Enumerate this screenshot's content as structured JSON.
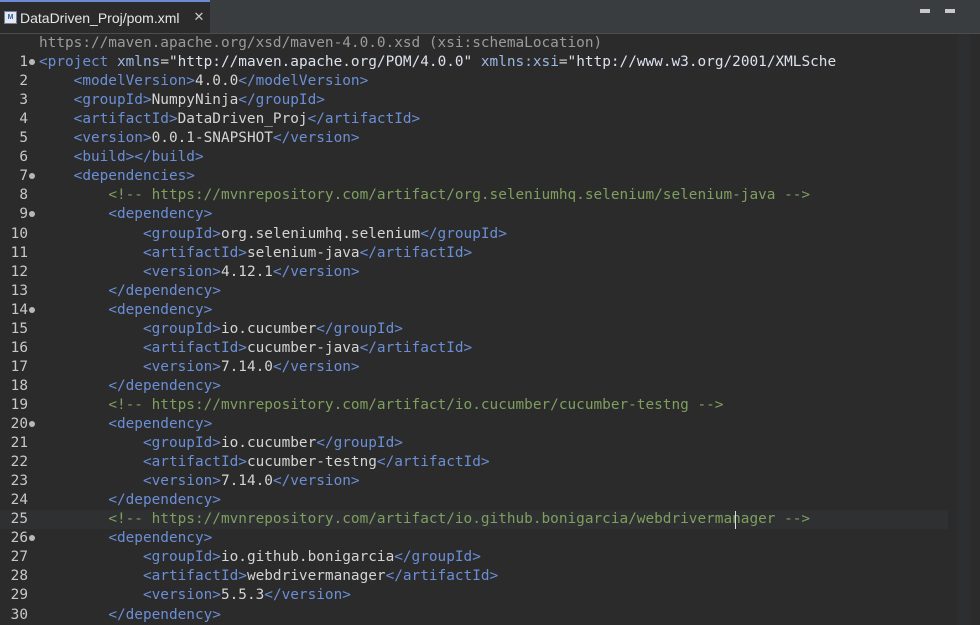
{
  "tab": {
    "title": "DataDriven_Proj/pom.xml",
    "icon": "maven-file-icon",
    "icon_text": "M",
    "close": "✕"
  },
  "editor": {
    "current_line": 25,
    "lines": [
      {
        "num": "",
        "fold": false,
        "tokens": [
          {
            "t": "text",
            "v": "https://maven.apache.org/xsd/maven-4.0.0.xsd (xsi:schemaLocation)",
            "color": "#9b9b9b"
          }
        ]
      },
      {
        "num": "1",
        "fold": true,
        "tokens": [
          {
            "t": "tag",
            "v": "<project "
          },
          {
            "t": "attr",
            "v": "xmlns"
          },
          {
            "t": "text",
            "v": "="
          },
          {
            "t": "value",
            "v": "\"http://maven.apache.org/POM/4.0.0\" "
          },
          {
            "t": "attr",
            "v": "xmlns:xsi"
          },
          {
            "t": "text",
            "v": "="
          },
          {
            "t": "value",
            "v": "\"http://www.w3.org/2001/XMLSche"
          }
        ]
      },
      {
        "num": "2",
        "fold": false,
        "tokens": [
          {
            "t": "text",
            "v": "    "
          },
          {
            "t": "tag",
            "v": "<modelVersion>"
          },
          {
            "t": "text",
            "v": "4.0.0"
          },
          {
            "t": "tag",
            "v": "</modelVersion>"
          }
        ]
      },
      {
        "num": "3",
        "fold": false,
        "tokens": [
          {
            "t": "text",
            "v": "    "
          },
          {
            "t": "tag",
            "v": "<groupId>"
          },
          {
            "t": "text",
            "v": "NumpyNinja"
          },
          {
            "t": "tag",
            "v": "</groupId>"
          }
        ]
      },
      {
        "num": "4",
        "fold": false,
        "tokens": [
          {
            "t": "text",
            "v": "    "
          },
          {
            "t": "tag",
            "v": "<artifactId>"
          },
          {
            "t": "text",
            "v": "DataDriven_Proj"
          },
          {
            "t": "tag",
            "v": "</artifactId>"
          }
        ]
      },
      {
        "num": "5",
        "fold": false,
        "tokens": [
          {
            "t": "text",
            "v": "    "
          },
          {
            "t": "tag",
            "v": "<version>"
          },
          {
            "t": "text",
            "v": "0.0.1-SNAPSHOT"
          },
          {
            "t": "tag",
            "v": "</version>"
          }
        ]
      },
      {
        "num": "6",
        "fold": false,
        "tokens": [
          {
            "t": "text",
            "v": "    "
          },
          {
            "t": "tag",
            "v": "<build></build>"
          }
        ]
      },
      {
        "num": "7",
        "fold": true,
        "tokens": [
          {
            "t": "text",
            "v": "    "
          },
          {
            "t": "tag",
            "v": "<dependencies>"
          }
        ]
      },
      {
        "num": "8",
        "fold": false,
        "tokens": [
          {
            "t": "text",
            "v": "        "
          },
          {
            "t": "comment",
            "v": "<!-- https://mvnrepository.com/artifact/org.seleniumhq.selenium/selenium-java -->"
          }
        ]
      },
      {
        "num": "9",
        "fold": true,
        "tokens": [
          {
            "t": "text",
            "v": "        "
          },
          {
            "t": "tag",
            "v": "<dependency>"
          }
        ]
      },
      {
        "num": "10",
        "fold": false,
        "tokens": [
          {
            "t": "text",
            "v": "            "
          },
          {
            "t": "tag",
            "v": "<groupId>"
          },
          {
            "t": "text",
            "v": "org.seleniumhq.selenium"
          },
          {
            "t": "tag",
            "v": "</groupId>"
          }
        ]
      },
      {
        "num": "11",
        "fold": false,
        "tokens": [
          {
            "t": "text",
            "v": "            "
          },
          {
            "t": "tag",
            "v": "<artifactId>"
          },
          {
            "t": "text",
            "v": "selenium-java"
          },
          {
            "t": "tag",
            "v": "</artifactId>"
          }
        ]
      },
      {
        "num": "12",
        "fold": false,
        "tokens": [
          {
            "t": "text",
            "v": "            "
          },
          {
            "t": "tag",
            "v": "<version>"
          },
          {
            "t": "text",
            "v": "4.12.1"
          },
          {
            "t": "tag",
            "v": "</version>"
          }
        ]
      },
      {
        "num": "13",
        "fold": false,
        "tokens": [
          {
            "t": "text",
            "v": "        "
          },
          {
            "t": "tag",
            "v": "</dependency>"
          }
        ]
      },
      {
        "num": "14",
        "fold": true,
        "tokens": [
          {
            "t": "text",
            "v": "        "
          },
          {
            "t": "tag",
            "v": "<dependency>"
          }
        ]
      },
      {
        "num": "15",
        "fold": false,
        "tokens": [
          {
            "t": "text",
            "v": "            "
          },
          {
            "t": "tag",
            "v": "<groupId>"
          },
          {
            "t": "text",
            "v": "io.cucumber"
          },
          {
            "t": "tag",
            "v": "</groupId>"
          }
        ]
      },
      {
        "num": "16",
        "fold": false,
        "tokens": [
          {
            "t": "text",
            "v": "            "
          },
          {
            "t": "tag",
            "v": "<artifactId>"
          },
          {
            "t": "text",
            "v": "cucumber-java"
          },
          {
            "t": "tag",
            "v": "</artifactId>"
          }
        ]
      },
      {
        "num": "17",
        "fold": false,
        "tokens": [
          {
            "t": "text",
            "v": "            "
          },
          {
            "t": "tag",
            "v": "<version>"
          },
          {
            "t": "text",
            "v": "7.14.0"
          },
          {
            "t": "tag",
            "v": "</version>"
          }
        ]
      },
      {
        "num": "18",
        "fold": false,
        "tokens": [
          {
            "t": "text",
            "v": "        "
          },
          {
            "t": "tag",
            "v": "</dependency>"
          }
        ]
      },
      {
        "num": "19",
        "fold": false,
        "tokens": [
          {
            "t": "text",
            "v": "        "
          },
          {
            "t": "comment",
            "v": "<!-- https://mvnrepository.com/artifact/io.cucumber/cucumber-testng -->"
          }
        ]
      },
      {
        "num": "20",
        "fold": true,
        "tokens": [
          {
            "t": "text",
            "v": "        "
          },
          {
            "t": "tag",
            "v": "<dependency>"
          }
        ]
      },
      {
        "num": "21",
        "fold": false,
        "tokens": [
          {
            "t": "text",
            "v": "            "
          },
          {
            "t": "tag",
            "v": "<groupId>"
          },
          {
            "t": "text",
            "v": "io.cucumber"
          },
          {
            "t": "tag",
            "v": "</groupId>"
          }
        ]
      },
      {
        "num": "22",
        "fold": false,
        "tokens": [
          {
            "t": "text",
            "v": "            "
          },
          {
            "t": "tag",
            "v": "<artifactId>"
          },
          {
            "t": "text",
            "v": "cucumber-testng"
          },
          {
            "t": "tag",
            "v": "</artifactId>"
          }
        ]
      },
      {
        "num": "23",
        "fold": false,
        "tokens": [
          {
            "t": "text",
            "v": "            "
          },
          {
            "t": "tag",
            "v": "<version>"
          },
          {
            "t": "text",
            "v": "7.14.0"
          },
          {
            "t": "tag",
            "v": "</version>"
          }
        ]
      },
      {
        "num": "24",
        "fold": false,
        "tokens": [
          {
            "t": "text",
            "v": "        "
          },
          {
            "t": "tag",
            "v": "</dependency>"
          }
        ]
      },
      {
        "num": "25",
        "fold": false,
        "tokens": [
          {
            "t": "text",
            "v": "        "
          },
          {
            "t": "comment",
            "v": "<!-- https://mvnrepository.com/artifact/io.github.bonigarcia/webdrivermanager -->"
          }
        ]
      },
      {
        "num": "26",
        "fold": true,
        "tokens": [
          {
            "t": "text",
            "v": "        "
          },
          {
            "t": "tag",
            "v": "<dependency>"
          }
        ]
      },
      {
        "num": "27",
        "fold": false,
        "tokens": [
          {
            "t": "text",
            "v": "            "
          },
          {
            "t": "tag",
            "v": "<groupId>"
          },
          {
            "t": "text",
            "v": "io.github.bonigarcia"
          },
          {
            "t": "tag",
            "v": "</groupId>"
          }
        ]
      },
      {
        "num": "28",
        "fold": false,
        "tokens": [
          {
            "t": "text",
            "v": "            "
          },
          {
            "t": "tag",
            "v": "<artifactId>"
          },
          {
            "t": "text",
            "v": "webdrivermanager"
          },
          {
            "t": "tag",
            "v": "</artifactId>"
          }
        ]
      },
      {
        "num": "29",
        "fold": false,
        "tokens": [
          {
            "t": "text",
            "v": "            "
          },
          {
            "t": "tag",
            "v": "<version>"
          },
          {
            "t": "text",
            "v": "5.5.3"
          },
          {
            "t": "tag",
            "v": "</version>"
          }
        ]
      },
      {
        "num": "30",
        "fold": false,
        "tokens": [
          {
            "t": "text",
            "v": "        "
          },
          {
            "t": "tag",
            "v": "</dependency>"
          }
        ]
      }
    ]
  }
}
